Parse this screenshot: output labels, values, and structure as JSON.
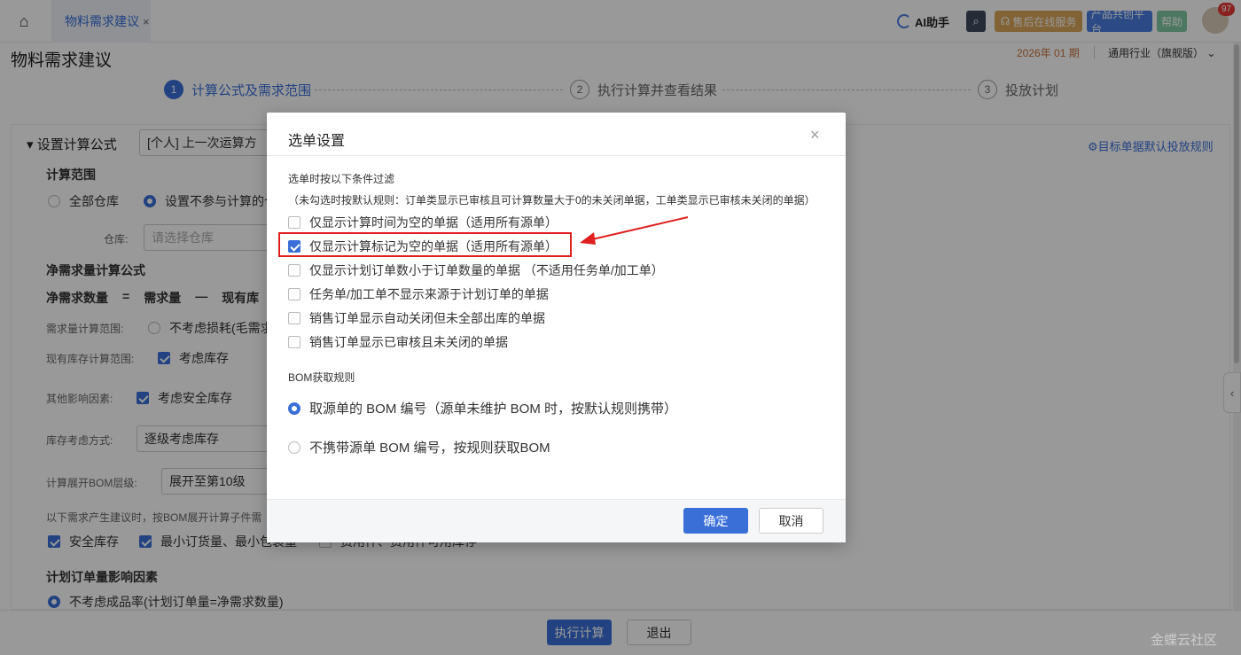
{
  "topbar": {
    "tab_label": "物料需求建议",
    "tab_close": "×",
    "ai_label": "AI助手",
    "service_label": "售后在线服务",
    "co_create_label": "产品共创平台",
    "help_label": "帮助",
    "notification_count": "97"
  },
  "page": {
    "title": "物料需求建议",
    "period": "2026年 01 期",
    "industry": "通用行业（旗舰版）",
    "right_link": "目标单据默认投放规则"
  },
  "steps": [
    {
      "num": "1",
      "label": "计算公式及需求范围"
    },
    {
      "num": "2",
      "label": "执行计算并查看结果"
    },
    {
      "num": "3",
      "label": "投放计划"
    }
  ],
  "form": {
    "section_title": "设置计算公式",
    "formula_select": "[个人] 上一次运算方",
    "scope_title": "计算范围",
    "radio_all_wh": "全部仓库",
    "radio_exclude_wh": "设置不参与计算的仓",
    "wh_label": "仓库:",
    "wh_placeholder": "请选择仓库",
    "net_title": "净需求量计算公式",
    "net_a": "净需求数量",
    "op_eq": "=",
    "net_b": "需求量",
    "op_minus": "—",
    "net_c": "现有库",
    "demand_scope_label": "需求量计算范围:",
    "demand_scope_value": "不考虑损耗(毛需求",
    "stock_scope_label": "现有库存计算范围:",
    "stock_scope_value": "考虑库存",
    "other_label": "其他影响因素:",
    "other_value": "考虑安全库存",
    "stock_mode_label": "库存考虑方式:",
    "stock_mode_value": "逐级考虑库存",
    "bom_level_label": "计算展开BOM层级:",
    "bom_level_value": "展开至第10级",
    "note": "以下需求产生建议时，按BOM展开计算子件需",
    "chk_safety": "安全库存",
    "chk_min": "最小订货量、最小包装量",
    "chk_hidden": "费用件、费用件可用库存",
    "plan_title": "计划订单量影响因素",
    "plan_radio": "不考虑成品率(计划订单量=净需求数量)"
  },
  "footer": {
    "run_label": "执行计算",
    "exit_label": "退出"
  },
  "dialog": {
    "title": "选单设置",
    "close": "×",
    "filter_title": "选单时按以下条件过滤",
    "filter_note": "（未勾选时按默认规则：订单类显示已审核且可计算数量大于0的未关闭单据，工单类显示已审核未关闭的单据）",
    "options": [
      {
        "label": "仅显示计算时间为空的单据（适用所有源单）",
        "checked": false
      },
      {
        "label": "仅显示计算标记为空的单据（适用所有源单）",
        "checked": true
      },
      {
        "label": "仅显示计划订单数小于订单数量的单据 （不适用任务单/加工单）",
        "checked": false
      },
      {
        "label": "任务单/加工单不显示来源于计划订单的单据",
        "checked": false
      },
      {
        "label": "销售订单显示自动关闭但未全部出库的单据",
        "checked": false
      },
      {
        "label": "销售订单显示已审核且未关闭的单据",
        "checked": false
      }
    ],
    "bom_title": "BOM获取规则",
    "bom_options": [
      {
        "label": "取源单的 BOM 编号（源单未维护 BOM 时，按默认规则携带）",
        "selected": true
      },
      {
        "label": "不携带源单 BOM 编号，按规则获取BOM",
        "selected": false
      }
    ],
    "ok_label": "确定",
    "cancel_label": "取消"
  },
  "watermark": "金蝶云社区",
  "colors": {
    "accent": "#3a6fd8",
    "highlight": "#e02020",
    "service": "#d9a55a",
    "cocreate": "#4a7de0",
    "help": "#7fc6a0"
  }
}
